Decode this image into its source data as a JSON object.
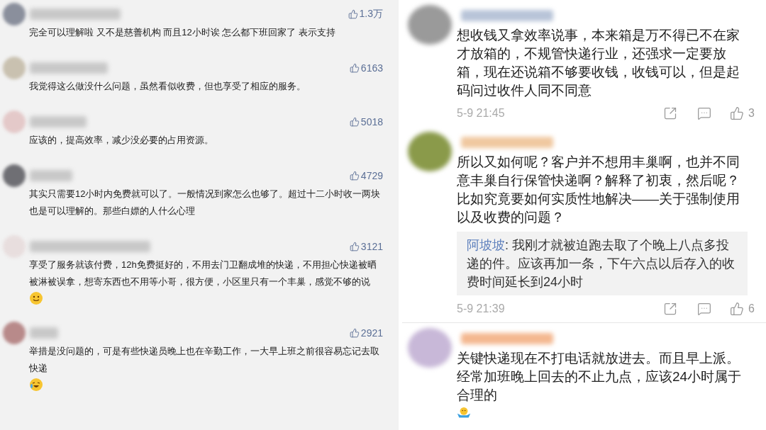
{
  "left_comments": [
    {
      "kind": "plain",
      "likes": "1.3万",
      "text": "完全可以理解啦 又不是慈善机构 而且12小时诶 怎么都下班回家了 表示支持"
    },
    {
      "kind": "plain",
      "likes": "6163",
      "text": "我觉得这么做没什么问题，虽然看似收费，但也享受了相应的服务。"
    },
    {
      "kind": "plain",
      "likes": "5018",
      "text": "应该的，提高效率，减少没必要的占用资源。"
    },
    {
      "kind": "plain",
      "likes": "4729",
      "text": "其实只需要12小时内免费就可以了。一般情况到家怎么也够了。超过十二小时收一两块也是可以理解的。那些白嫖的人什么心理"
    },
    {
      "kind": "smile_emoji",
      "likes": "3121",
      "text": "享受了服务就该付费，12h免费挺好的，不用去门卫翻成堆的快递，不用担心快递被晒被淋被误拿，想寄东西也不用等小哥，很方便，小区里只有一个丰巢，感觉不够的说"
    },
    {
      "kind": "laugh_emoji",
      "likes": "2921",
      "text": "举措是没问题的，可是有些快递员晚上也在辛勤工作，一大早上班之前很容易忘记去取快递"
    }
  ],
  "right_comments": [
    {
      "kind": "plain",
      "text": "想收钱又拿效率说事，本来箱是万不得已不在家才放箱的，不规管快递行业，还强求一定要放箱，现在还说箱不够要收钱，收钱可以，但是起码问过收件人同不同意",
      "time": "5-9 21:45",
      "likes": "3"
    },
    {
      "kind": "plain",
      "text": "所以又如何呢？客户并不想用丰巢啊，也并不同意丰巢自行保管快递啊？解释了初衷，然后呢？比如究竟要如何实质性地解决——关于强制使用以及收费的问题？",
      "reply": {
        "author": "阿坡坡",
        "text": ": 我刚才就被迫跑去取了个晚上八点多投递的件。应该再加一条，下午六点以后存入的收费时间延长到24小时"
      },
      "time": "5-9 21:39",
      "likes": "6"
    },
    {
      "kind": "shrug_emoji",
      "text": "关键快递现在不打电话就放进去。而且早上派。经常加班晚上回去的不止九点，应该24小时属于合理的"
    }
  ]
}
